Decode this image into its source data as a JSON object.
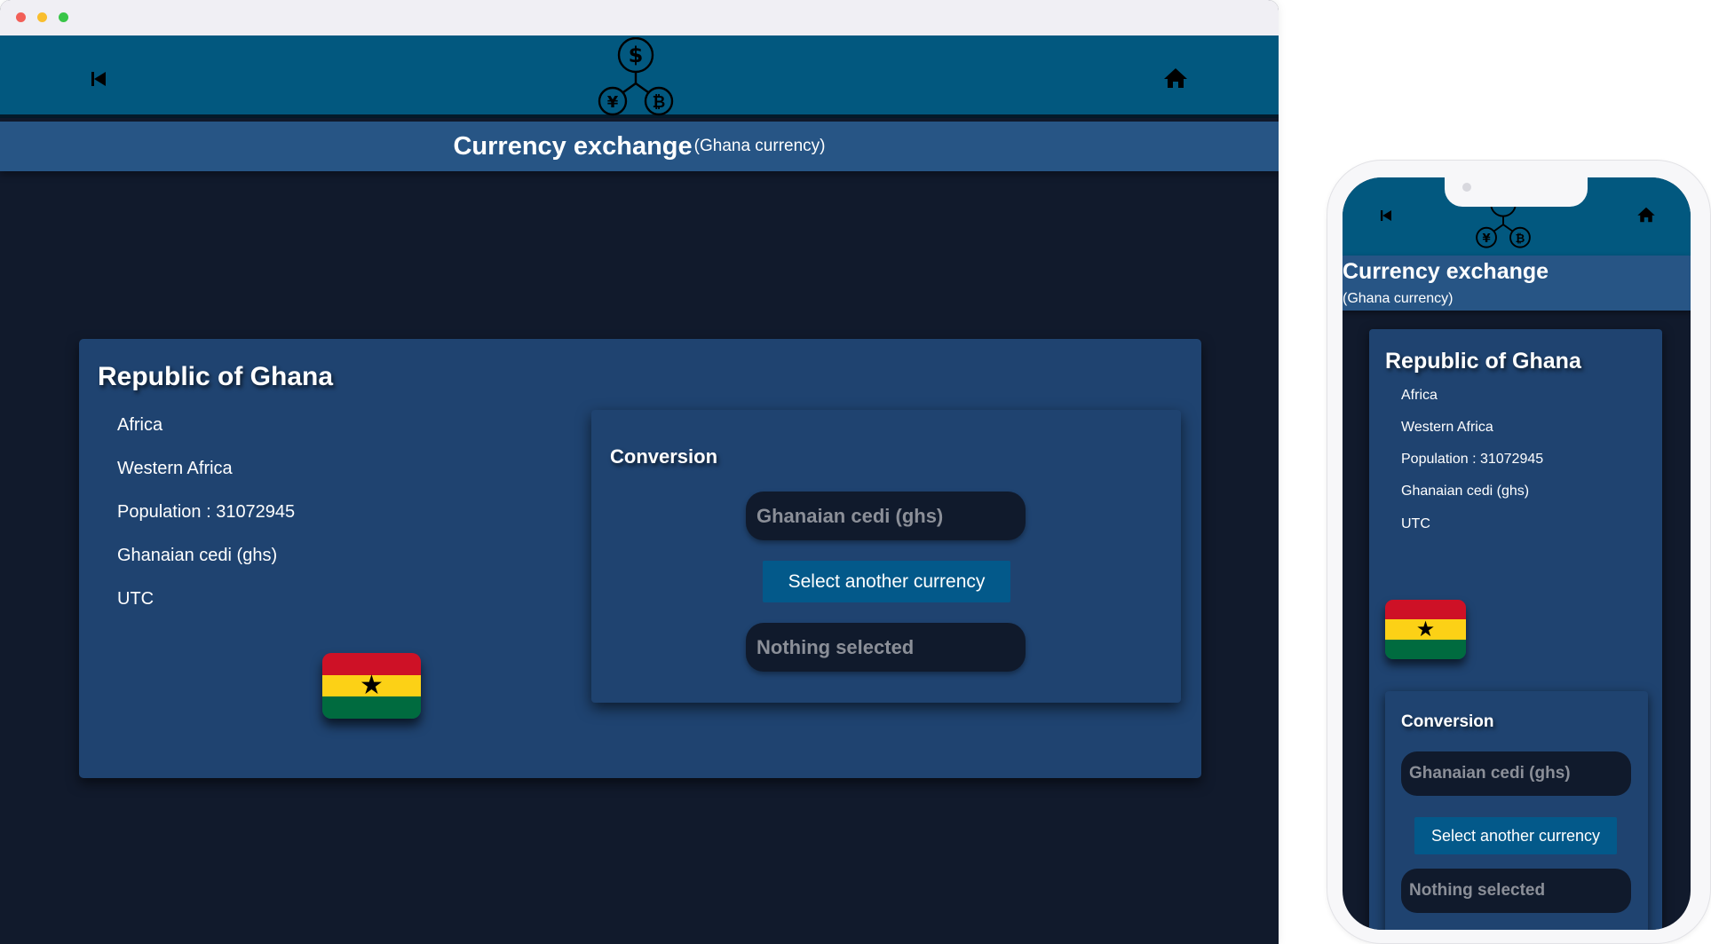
{
  "header": {
    "title": "Currency exchange",
    "subtitle": "(Ghana currency)",
    "back_icon": "skip-back-icon",
    "home_icon": "home-icon",
    "logo_icon": "currency-exchange-logo-icon"
  },
  "country": {
    "name": "Republic of Ghana",
    "region": "Africa",
    "subregion": "Western Africa",
    "population": "Population : 31072945",
    "currency": "Ghanaian cedi (ghs)",
    "timezone": "UTC",
    "flag": {
      "colors": [
        "#ce1126",
        "#fcd116",
        "#006b3f"
      ],
      "star": "★"
    }
  },
  "conversion": {
    "title": "Conversion",
    "from_currency": "Ghanaian cedi (ghs)",
    "select_button": "Select another currency",
    "to_currency": "Nothing selected"
  },
  "colors": {
    "header_bg": "#02587f",
    "subheader_bg": "#275585",
    "page_bg": "#111a2c",
    "card_bg": "#1f4370",
    "button_bg": "#03598a"
  }
}
